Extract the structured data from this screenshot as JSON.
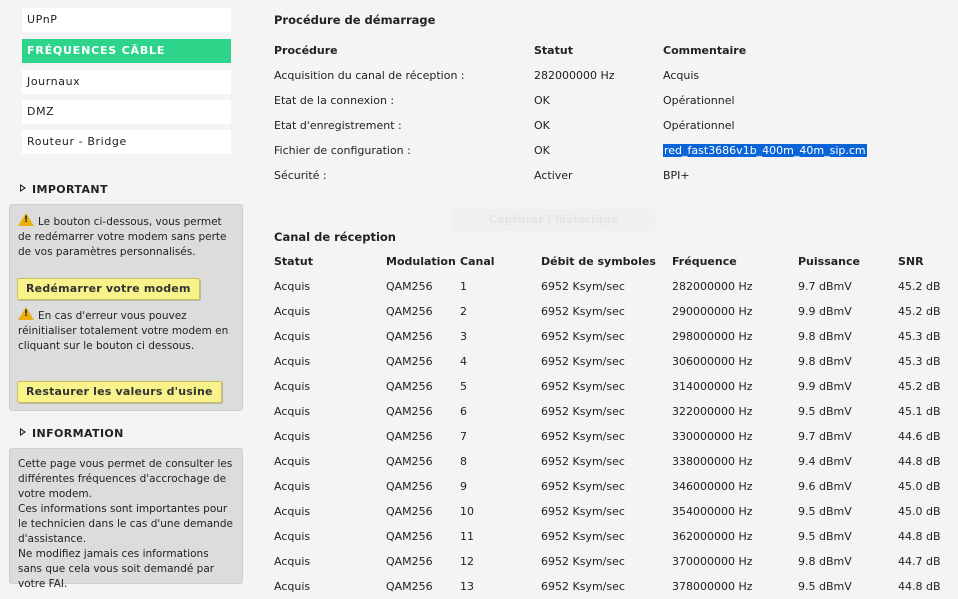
{
  "sidebar": {
    "nav": [
      {
        "label": "UPnP",
        "active": false
      },
      {
        "label": "FRÉQUENCES CÂBLE",
        "active": true
      },
      {
        "label": "Journaux",
        "active": false
      },
      {
        "label": "DMZ",
        "active": false
      },
      {
        "label": "Routeur - Bridge",
        "active": false
      }
    ],
    "important": {
      "title": "IMPORTANT",
      "text1": "Le bouton ci-dessous, vous permet de redémarrer votre modem sans perte de vos paramètres personnalisés.",
      "restart_button": "Redémarrer votre modem",
      "text2": "En cas d'erreur vous pouvez réinitialiser totalement votre modem en cliquant sur le bouton ci dessous.",
      "restore_button": "Restaurer les valeurs d'usine"
    },
    "information": {
      "title": "INFORMATION",
      "lines": [
        "Cette page vous permet de consulter les différentes fréquences d'accrochage de votre modem.",
        "Ces informations sont importantes pour le technicien dans le cas d'une demande d'assistance.",
        "Ne modifiez jamais ces informations sans que cela vous soit demandé par votre FAI."
      ]
    },
    "accent_color": "#2ed48a"
  },
  "startup": {
    "title": "Procédure de démarrage",
    "headers": {
      "procedure": "Procédure",
      "status": "Statut",
      "comment": "Commentaire"
    },
    "rows": [
      {
        "procedure": "Acquisition du canal de réception :",
        "status": "282000000 Hz",
        "comment": "Acquis"
      },
      {
        "procedure": "Etat de la connexion :",
        "status": "OK",
        "comment": "Opérationnel"
      },
      {
        "procedure": "Etat d'enregistrement :",
        "status": "OK",
        "comment": "Opérationnel"
      },
      {
        "procedure": "Fichier de configuration :",
        "status": "OK",
        "comment": "red_fast3686v1b_400m_40m_sip.cm"
      },
      {
        "procedure": "Sécurité :",
        "status": "Activer",
        "comment": "BPI+"
      }
    ],
    "ghost_button": "Capturer l'historique"
  },
  "downstream": {
    "title": "Canal de réception",
    "headers": {
      "status": "Statut",
      "modulation": "Modulation",
      "channel": "Canal",
      "symbol_rate": "Débit de symboles",
      "frequency": "Fréquence",
      "power": "Puissance",
      "snr": "SNR"
    },
    "rows": [
      {
        "status": "Acquis",
        "modulation": "QAM256",
        "channel": "1",
        "symbol_rate": "6952 Ksym/sec",
        "frequency": "282000000 Hz",
        "power": "9.7 dBmV",
        "snr": "45.2 dB"
      },
      {
        "status": "Acquis",
        "modulation": "QAM256",
        "channel": "2",
        "symbol_rate": "6952 Ksym/sec",
        "frequency": "290000000 Hz",
        "power": "9.9 dBmV",
        "snr": "45.2 dB"
      },
      {
        "status": "Acquis",
        "modulation": "QAM256",
        "channel": "3",
        "symbol_rate": "6952 Ksym/sec",
        "frequency": "298000000 Hz",
        "power": "9.8 dBmV",
        "snr": "45.3 dB"
      },
      {
        "status": "Acquis",
        "modulation": "QAM256",
        "channel": "4",
        "symbol_rate": "6952 Ksym/sec",
        "frequency": "306000000 Hz",
        "power": "9.8 dBmV",
        "snr": "45.3 dB"
      },
      {
        "status": "Acquis",
        "modulation": "QAM256",
        "channel": "5",
        "symbol_rate": "6952 Ksym/sec",
        "frequency": "314000000 Hz",
        "power": "9.9 dBmV",
        "snr": "45.2 dB"
      },
      {
        "status": "Acquis",
        "modulation": "QAM256",
        "channel": "6",
        "symbol_rate": "6952 Ksym/sec",
        "frequency": "322000000 Hz",
        "power": "9.5 dBmV",
        "snr": "45.1 dB"
      },
      {
        "status": "Acquis",
        "modulation": "QAM256",
        "channel": "7",
        "symbol_rate": "6952 Ksym/sec",
        "frequency": "330000000 Hz",
        "power": "9.7 dBmV",
        "snr": "44.6 dB"
      },
      {
        "status": "Acquis",
        "modulation": "QAM256",
        "channel": "8",
        "symbol_rate": "6952 Ksym/sec",
        "frequency": "338000000 Hz",
        "power": "9.4 dBmV",
        "snr": "44.8 dB"
      },
      {
        "status": "Acquis",
        "modulation": "QAM256",
        "channel": "9",
        "symbol_rate": "6952 Ksym/sec",
        "frequency": "346000000 Hz",
        "power": "9.6 dBmV",
        "snr": "45.0 dB"
      },
      {
        "status": "Acquis",
        "modulation": "QAM256",
        "channel": "10",
        "symbol_rate": "6952 Ksym/sec",
        "frequency": "354000000 Hz",
        "power": "9.5 dBmV",
        "snr": "45.0 dB"
      },
      {
        "status": "Acquis",
        "modulation": "QAM256",
        "channel": "11",
        "symbol_rate": "6952 Ksym/sec",
        "frequency": "362000000 Hz",
        "power": "9.5 dBmV",
        "snr": "44.8 dB"
      },
      {
        "status": "Acquis",
        "modulation": "QAM256",
        "channel": "12",
        "symbol_rate": "6952 Ksym/sec",
        "frequency": "370000000 Hz",
        "power": "9.8 dBmV",
        "snr": "44.7 dB"
      },
      {
        "status": "Acquis",
        "modulation": "QAM256",
        "channel": "13",
        "symbol_rate": "6952 Ksym/sec",
        "frequency": "378000000 Hz",
        "power": "9.5 dBmV",
        "snr": "44.8 dB"
      }
    ]
  }
}
